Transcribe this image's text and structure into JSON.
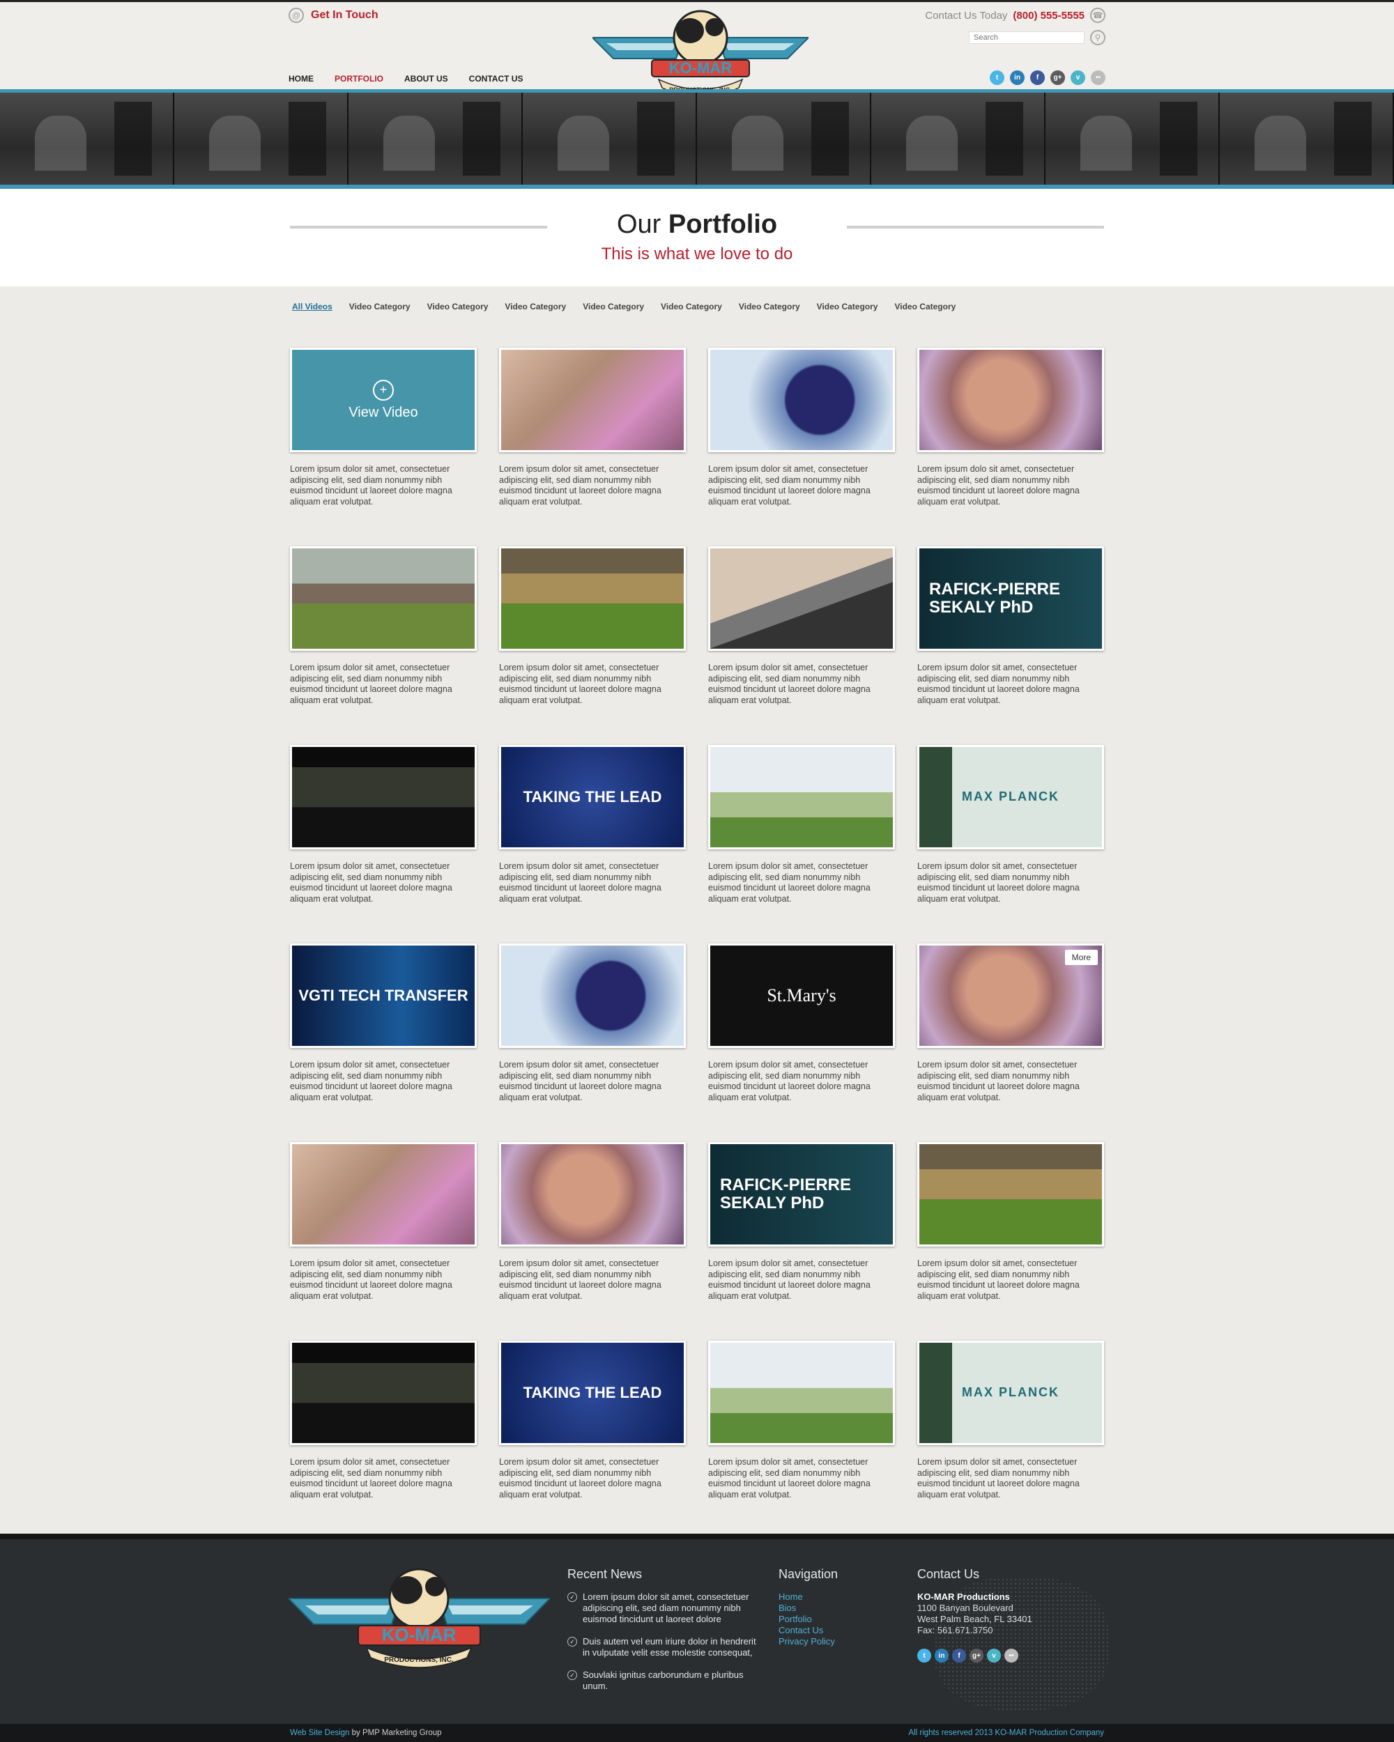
{
  "header": {
    "get_in_touch": "Get In Touch",
    "contact_today_label": "Contact Us Today",
    "phone": "(800) 555-5555",
    "search_placeholder": "Search",
    "nav": [
      {
        "label": "HOME"
      },
      {
        "label": "PORTFOLIO",
        "active": true
      },
      {
        "label": "ABOUT US"
      },
      {
        "label": "CONTACT US"
      }
    ],
    "socials": [
      {
        "icon": "twitter-icon",
        "glyph": "t",
        "color": "#4bb5e8"
      },
      {
        "icon": "linkedin-icon",
        "glyph": "in",
        "color": "#2a7fb8"
      },
      {
        "icon": "facebook-icon",
        "glyph": "f",
        "color": "#3b5a9a"
      },
      {
        "icon": "googleplus-icon",
        "glyph": "g+",
        "color": "#5c5c5c"
      },
      {
        "icon": "vimeo-icon",
        "glyph": "v",
        "color": "#4bb5c8"
      },
      {
        "icon": "flickr-icon",
        "glyph": "••",
        "color": "#bbbbbb"
      }
    ]
  },
  "logo": {
    "name": "KO-MAR",
    "tagline": "PRODUCTIONS, INC."
  },
  "title": {
    "light": "Our",
    "bold": "Portfolio",
    "subtitle": "This is what we love to do"
  },
  "filters": [
    "All Videos",
    "Video Category",
    "Video Category",
    "Video Category",
    "Video Category",
    "Video Category",
    "Video Category",
    "Video Category",
    "Video Category"
  ],
  "lorem": "Lorem ipsum dolor sit amet, consectetuer adipiscing elit, sed diam nonummy nibh euismod tincidunt ut laoreet dolore magna aliquam erat volutpat.",
  "lorem_alt": "Lorem ipsum dolo sit amet, consectetuer adipiscing elit, sed diam nonummy nibh euismod tincidunt ut laoreet dolore magna aliquam erat volutpat.",
  "view_video": "View Video",
  "more": "More",
  "thumb_text": {
    "doc": "RAFICK-PIERRE SEKALY PhD",
    "vgti": "TAKING THE LEAD",
    "maxp": "MAX PLANCK",
    "tech": "VGTI TECH TRANSFER",
    "stm": "St.Mary's"
  },
  "grid": [
    "view",
    "mom",
    "glove",
    "lady",
    "yard",
    "crowd",
    "usb",
    "doc",
    "stadium",
    "vgti",
    "golf",
    "maxp",
    "tech",
    "glove",
    "stm",
    "lady-more",
    "mom",
    "lady",
    "doc",
    "crowd",
    "stadium",
    "vgti",
    "golf",
    "maxp"
  ],
  "footer": {
    "news_title": "Recent News",
    "news": [
      "Lorem ipsum dolor sit amet, consectetuer adipiscing elit, sed diam nonummy nibh euismod tincidunt ut laoreet dolore",
      "Duis autem vel eum iriure dolor in hendrerit in vulputate velit esse molestie consequat,",
      "Souvlaki ignitus carborundum e pluribus unum."
    ],
    "nav_title": "Navigation",
    "nav": [
      "Home",
      "Bios",
      "Portfolio",
      "Contact Us",
      "Privacy Policy"
    ],
    "contact_title": "Contact Us",
    "company": "KO-MAR Productions",
    "address1": "1100 Banyan Boulevard",
    "address2": "West Palm Beach, FL 33401",
    "fax": "Fax: 561.671.3750",
    "credit_link": "Web Site Design",
    "credit_by": " by ",
    "credit_company": "PMP Marketing Group",
    "rights": "All rights reserved 2013 KO-MAR Production Company"
  }
}
